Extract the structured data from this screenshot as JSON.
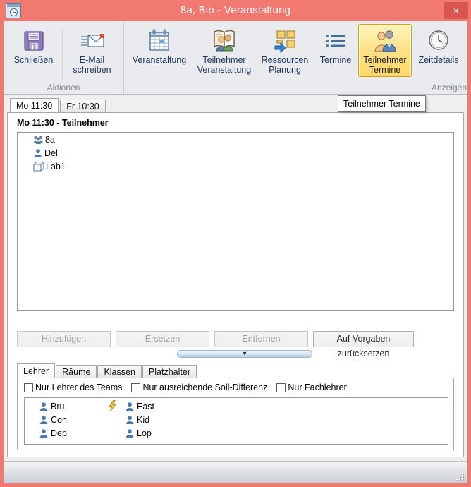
{
  "window": {
    "title": "8a, Bio - Veranstaltung",
    "icon": "calendar-clock-icon",
    "close_label": "×",
    "titlebar_color": "#F2796F",
    "close_button_color": "#D8564F"
  },
  "ribbon": {
    "groups": [
      {
        "label": "Aktionen",
        "items": [
          {
            "label": "Schließen",
            "icon": "save-floppy-icon",
            "active": false,
            "width": "narrow"
          },
          {
            "label": "E-Mail\nschreiben",
            "label_line1": "E-Mail",
            "label_line2": "schreiben",
            "icon": "email-icon",
            "active": false,
            "width": "normal"
          }
        ]
      },
      {
        "label": "Anzeigen",
        "items": [
          {
            "label": "Veranstaltung",
            "icon": "calendar-icon",
            "active": false,
            "width": "wide"
          },
          {
            "label_line1": "Teilnehmer",
            "label_line2": "Veranstaltung",
            "icon": "participants-book-icon",
            "active": false,
            "width": "wide"
          },
          {
            "label_line1": "Ressourcen",
            "label_line2": "Planung",
            "icon": "resource-planning-icon",
            "active": false,
            "width": "normal"
          },
          {
            "label": "Termine",
            "icon": "list-icon",
            "active": false,
            "width": "narrow"
          },
          {
            "label_line1": "Teilnehmer",
            "label_line2": "Termine",
            "icon": "participants-dates-icon",
            "active": true,
            "width": "normal"
          },
          {
            "label": "Zeitdetails",
            "icon": "clock-icon",
            "active": false,
            "width": "normal"
          }
        ]
      }
    ]
  },
  "tooltip": {
    "text": "Teilnehmer Termine"
  },
  "main": {
    "tabs": [
      {
        "label": "Mo 11:30",
        "selected": true
      },
      {
        "label": "Fr 10:30",
        "selected": false
      }
    ],
    "section_title": "Mo 11:30 - Teilnehmer",
    "participants": [
      {
        "name": "8a",
        "icon": "class-group-icon"
      },
      {
        "name": "Del",
        "icon": "person-icon"
      },
      {
        "name": "Lab1",
        "icon": "room-box-icon"
      }
    ],
    "buttons": [
      {
        "label": "Hinzufügen",
        "disabled": true,
        "width": "w1"
      },
      {
        "label": "Ersetzen",
        "disabled": true,
        "width": "w1"
      },
      {
        "label": "Entfernen",
        "disabled": true,
        "width": "w1"
      },
      {
        "label": "Auf Vorgaben zurücksetzen",
        "disabled": false,
        "width": "w2"
      }
    ],
    "splitter": {
      "icon": "chevron-down-icon",
      "glyph": "▾"
    }
  },
  "bottom": {
    "tabs": [
      {
        "label": "Lehrer",
        "selected": true
      },
      {
        "label": "Räume",
        "selected": false
      },
      {
        "label": "Klassen",
        "selected": false
      },
      {
        "label": "Platzhalter",
        "selected": false
      }
    ],
    "filters": [
      {
        "label": "Nur Lehrer des Teams",
        "checked": false
      },
      {
        "label": "Nur ausreichende Soll-Differenz",
        "checked": false
      },
      {
        "label": "Nur Fachlehrer",
        "checked": false
      }
    ],
    "teachers_column1": [
      {
        "name": "Bru",
        "icon": "person-icon",
        "flag": false
      },
      {
        "name": "Con",
        "icon": "person-icon",
        "flag": false
      },
      {
        "name": "Dep",
        "icon": "person-icon",
        "flag": false
      }
    ],
    "teachers_column2": [
      {
        "name": "East",
        "icon": "person-icon",
        "flag": true,
        "flag_icon": "lightning-bolt-icon"
      },
      {
        "name": "Kid",
        "icon": "person-icon",
        "flag": false
      },
      {
        "name": "Lop",
        "icon": "person-icon",
        "flag": false
      }
    ]
  }
}
